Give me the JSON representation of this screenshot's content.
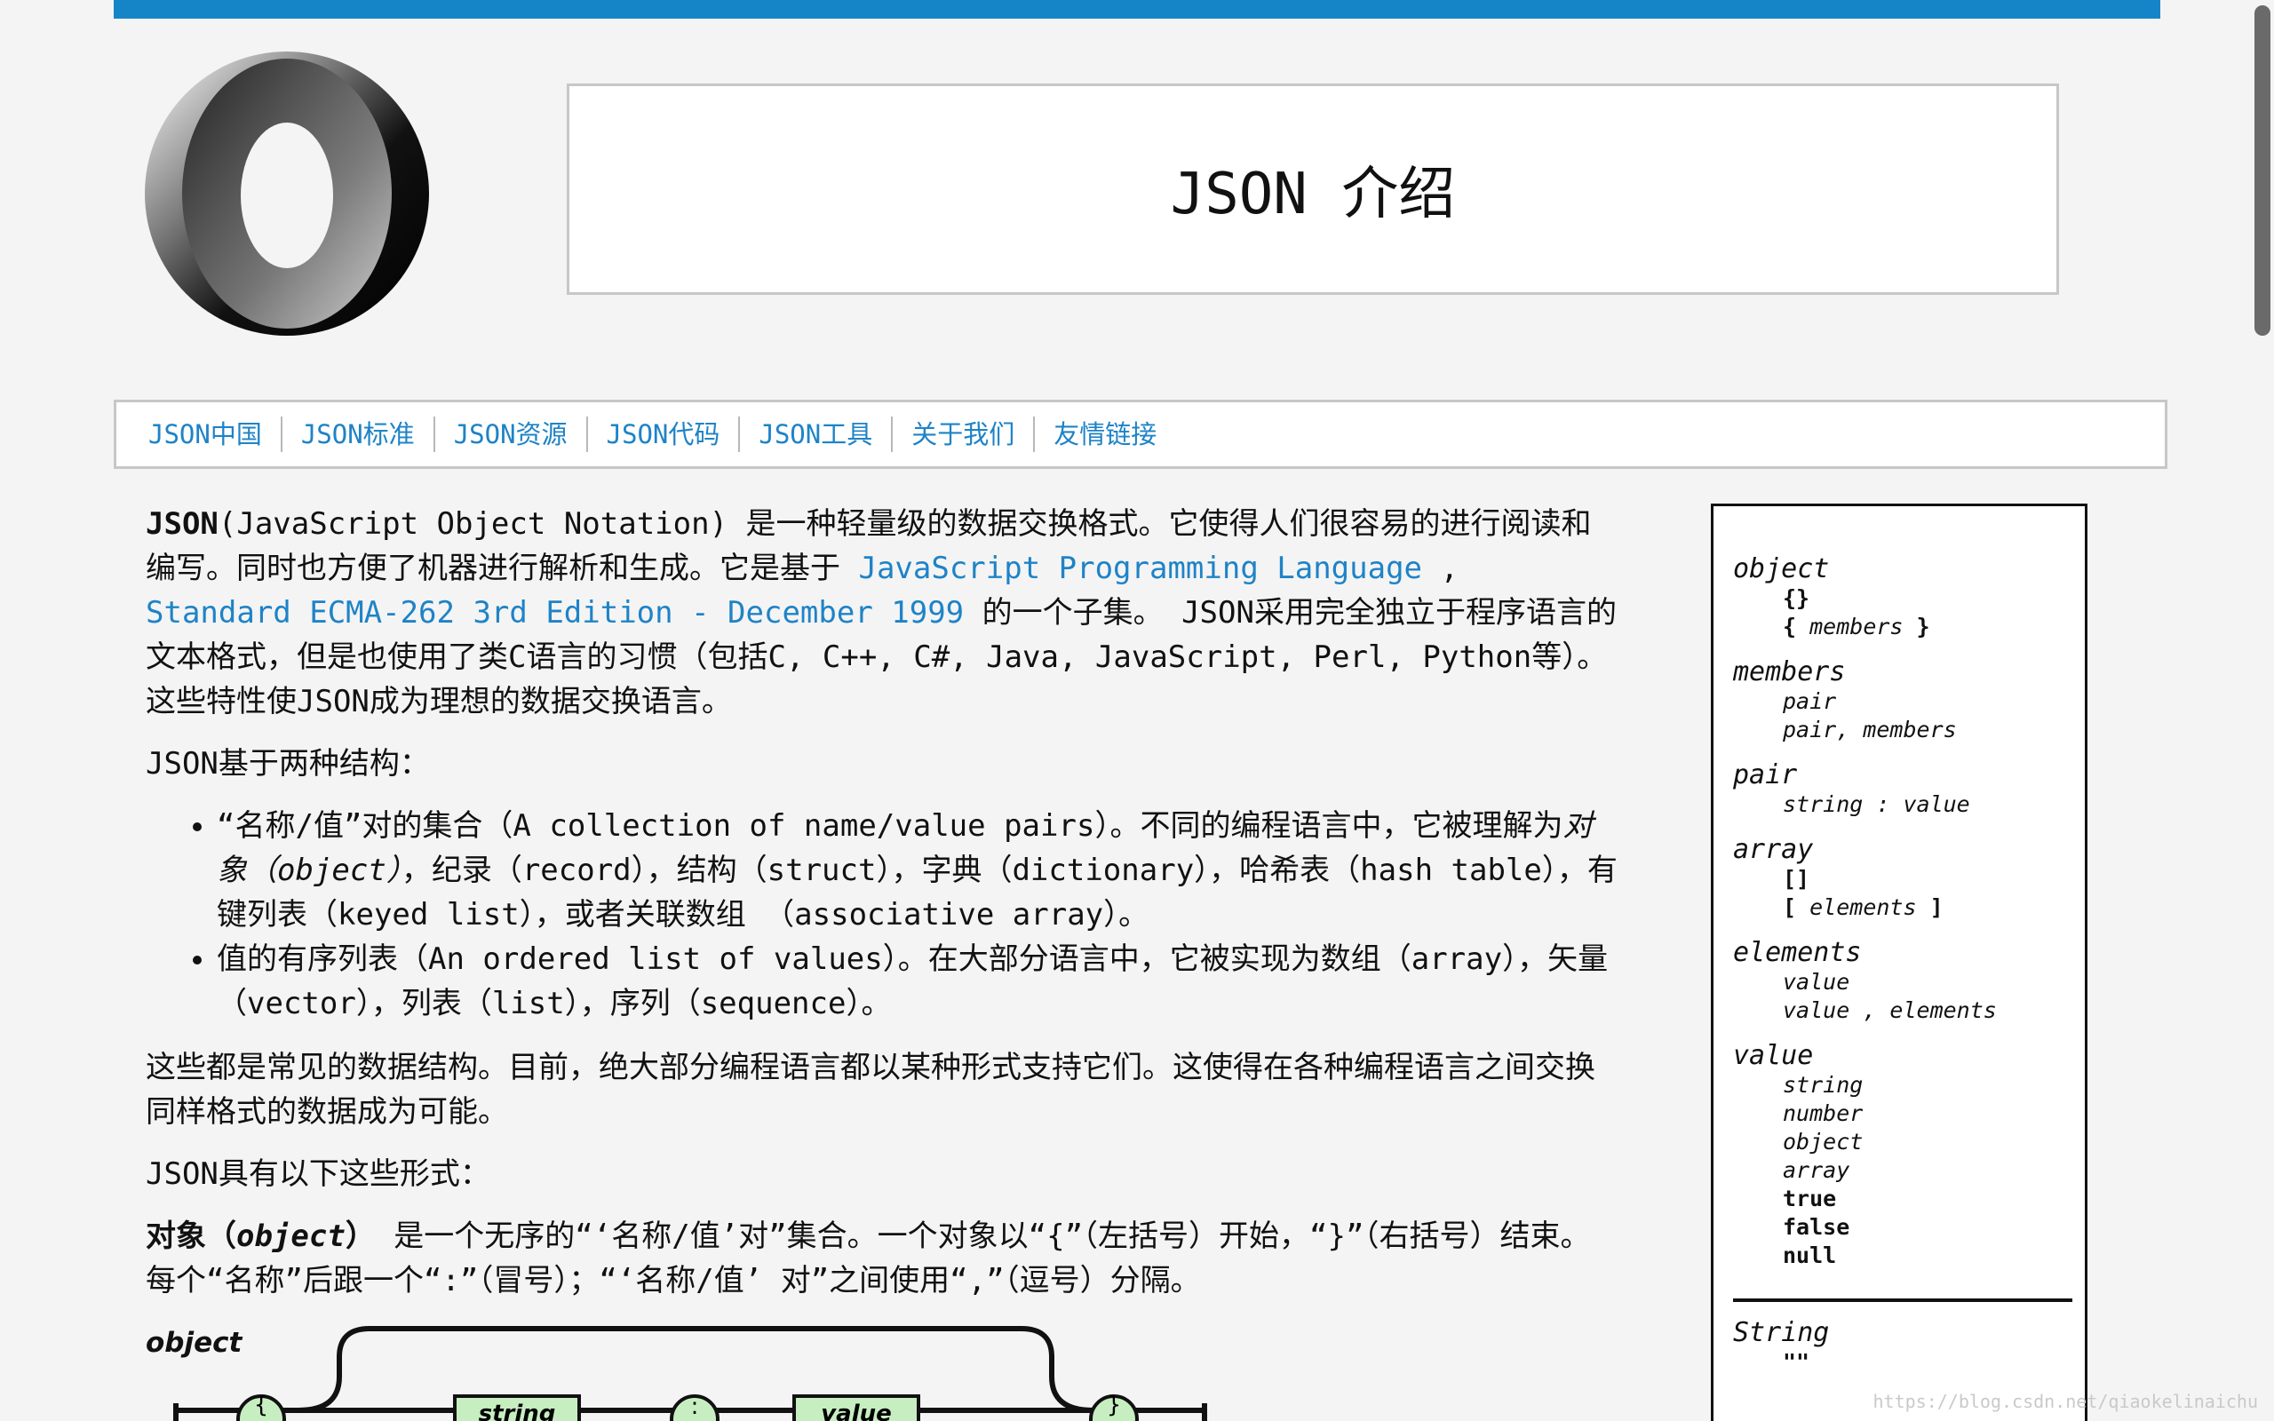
{
  "header": {
    "title": "JSON 介绍",
    "logo_icon": "json-logo-icon",
    "top_bar_color": "#1585c8"
  },
  "nav": {
    "items": [
      "JSON中国",
      "JSON标准",
      "JSON资源",
      "JSON代码",
      "JSON工具",
      "关于我们",
      "友情链接"
    ]
  },
  "intro": {
    "term": "JSON",
    "part1": "(JavaScript Object Notation) 是一种轻量级的数据交换格式。它使得人们很容易的进行阅读和编写。同时也方便了机器进行解析和生成。它是基于 ",
    "link1": "JavaScript Programming Language",
    "part2": " , ",
    "link2": "Standard ECMA-262 3rd Edition - December 1999",
    "part3": " 的一个子集。 JSON采用完全独立于程序语言的文本格式，但是也使用了类C语言的习惯（包括C, C++, C#, Java, JavaScript, Perl, Python等）。这些特性使JSON成为理想的数据交换语言。"
  },
  "structures": {
    "lead": "JSON基于两种结构：",
    "item1_a": "“名称/值”对的集合（A collection of name/value pairs）。不同的编程语言中，它被理解为",
    "item1_em": "对象（object）",
    "item1_b": "，纪录（record），结构（struct），字典（dictionary），哈希表（hash table），有键列表（keyed list），或者关联数组 （associative array）。",
    "item2": "值的有序列表（An ordered list of values）。在大部分语言中，它被实现为数组（array），矢量（vector），列表（list），序列（sequence）。"
  },
  "common": "这些都是常见的数据结构。目前，绝大部分编程语言都以某种形式支持它们。这使得在各种编程语言之间交换同样格式的数据成为可能。",
  "forms_lead": "JSON具有以下这些形式：",
  "object_def": {
    "term": "对象（",
    "term_em": "object",
    "term_end": "）",
    "text": " 是一个无序的“‘名称/值’对”集合。一个对象以“{”（左括号）开始，“}”（右括号）结束。每个“名称”后跟一个“:”（冒号）；“‘名称/值’ 对”之间使用“,”（逗号）分隔。"
  },
  "diagram": {
    "label": "object",
    "left_brace": "{",
    "string_box": "string",
    "colon": ":",
    "value_box": "value",
    "right_brace": "}"
  },
  "grammar": {
    "object": "object",
    "object_1": "{}",
    "object_2_open": "{",
    "object_2_mid": " members ",
    "object_2_close": "}",
    "members": "members",
    "members_1": "pair",
    "members_2": "pair, members",
    "pair": "pair",
    "pair_1": "string : value",
    "array": "array",
    "array_1": "[]",
    "array_2_open": "[",
    "array_2_mid": " elements ",
    "array_2_close": "]",
    "elements": "elements",
    "elements_1": "value",
    "elements_2": "value , elements",
    "value": "value",
    "value_1": "string",
    "value_2": "number",
    "value_3": "object",
    "value_4": "array",
    "value_5": "true",
    "value_6": "false",
    "value_7": "null",
    "string": "String",
    "string_1": "\"\""
  },
  "watermark": "https://blog.csdn.net/qiaokelinaichu"
}
